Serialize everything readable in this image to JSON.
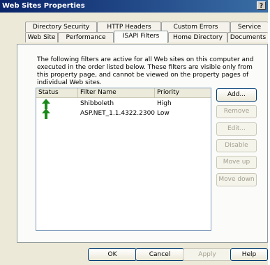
{
  "window": {
    "title": "Web Sites Properties",
    "help_label": "?"
  },
  "tabs_back": [
    "Directory Security",
    "HTTP Headers",
    "Custom Errors",
    "Service"
  ],
  "tabs_front": [
    "Web Site",
    "Performance",
    "ISAPI Filters",
    "Home Directory",
    "Documents"
  ],
  "active_tab": "ISAPI Filters",
  "description": "The following filters are active for all Web sites on this computer and executed in the order listed below. These filters are visible only from this property page, and cannot be viewed on the property pages of individual Web sites.",
  "filters_list": {
    "columns": [
      "Status",
      "Filter Name",
      "Priority"
    ],
    "rows": [
      {
        "status_icon": "green-up-arrow-icon",
        "name": "Shibboleth",
        "priority": "High"
      },
      {
        "status_icon": "green-up-arrow-icon",
        "name": "ASP.NET_1.1.4322.2300",
        "priority": "Low"
      }
    ]
  },
  "side_buttons": {
    "add": "Add...",
    "remove": "Remove",
    "edit": "Edit...",
    "disable": "Disable",
    "move_up": "Move up",
    "move_down": "Move down"
  },
  "footer": {
    "ok": "OK",
    "cancel": "Cancel",
    "apply": "Apply",
    "help": "Help"
  },
  "colors": {
    "title_start": "#0a246a",
    "title_end": "#3a6ea5",
    "status_arrow": "#1a8a1a"
  }
}
